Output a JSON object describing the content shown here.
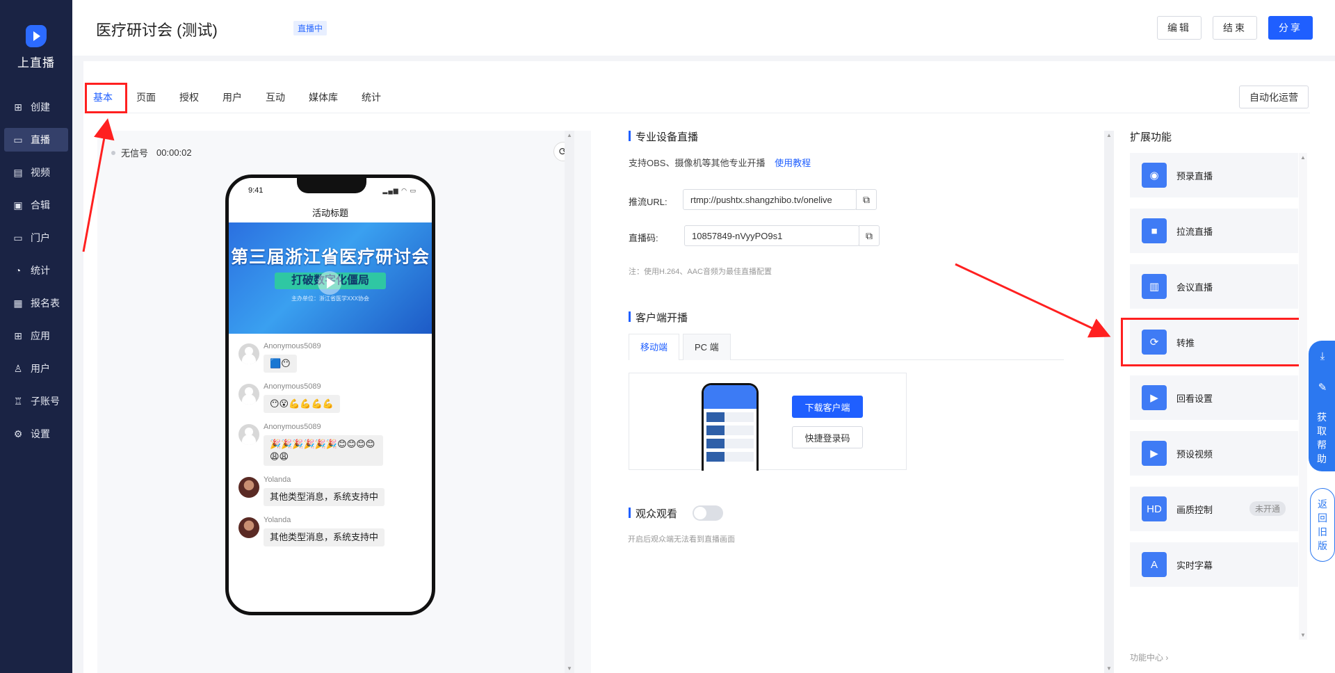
{
  "app": {
    "logo_text": "上直播"
  },
  "sidebar": {
    "items": [
      {
        "label": "创建",
        "icon": "plus-square-icon",
        "glyph": "⊞"
      },
      {
        "label": "直播",
        "icon": "video-camera-icon",
        "glyph": "▭"
      },
      {
        "label": "视频",
        "icon": "film-icon",
        "glyph": "▤"
      },
      {
        "label": "合辑",
        "icon": "collection-icon",
        "glyph": "▣"
      },
      {
        "label": "门户",
        "icon": "monitor-icon",
        "glyph": "▭"
      },
      {
        "label": "统计",
        "icon": "pie-chart-icon",
        "glyph": "◔"
      },
      {
        "label": "报名表",
        "icon": "form-icon",
        "glyph": "▦"
      },
      {
        "label": "应用",
        "icon": "apps-grid-icon",
        "glyph": "⊞"
      },
      {
        "label": "用户",
        "icon": "user-icon",
        "glyph": "♙"
      },
      {
        "label": "子账号",
        "icon": "sub-account-icon",
        "glyph": "♖"
      },
      {
        "label": "设置",
        "icon": "gear-icon",
        "glyph": "⚙"
      }
    ],
    "active_index": 1
  },
  "header": {
    "title": "医疗研讨会 (测试)",
    "status_badge": "直播中",
    "edit_label": "编辑",
    "end_label": "结束",
    "share_label": "分享"
  },
  "tabs": [
    "基本",
    "页面",
    "授权",
    "用户",
    "互动",
    "媒体库",
    "统计"
  ],
  "active_tab": "基本",
  "auto_ops_label": "自动化运营",
  "preview": {
    "signal_text": "无信号",
    "duration": "00:00:02",
    "phone_time": "9:41",
    "phone_title": "活动标题",
    "banner_title": "第三届浙江省医疗研讨会",
    "banner_subtitle": "打破数字化僵局",
    "banner_small": "主办单位：浙江省医学XXX协会",
    "messages": [
      {
        "user": "Anonymous5089",
        "text": "🟦😶",
        "avatar": "gray"
      },
      {
        "user": "Anonymous5089",
        "text": "😶😮💪💪💪💪",
        "avatar": "gray"
      },
      {
        "user": "Anonymous5089",
        "text": "🎉🎉🎉🎉🎉🎉😊😊😊😊😩😩",
        "avatar": "gray"
      },
      {
        "user": "Yolanda",
        "text": "其他类型消息，系统支持中",
        "avatar": "photo"
      },
      {
        "user": "Yolanda",
        "text": "其他类型消息，系统支持中",
        "avatar": "photo"
      }
    ]
  },
  "pro_device": {
    "title": "专业设备直播",
    "desc": "支持OBS、摄像机等其他专业开播",
    "tutorial_link": "使用教程",
    "push_url_label": "推流URL:",
    "push_url_value": "rtmp://pushtx.shangzhibo.tv/onelive",
    "stream_key_label": "直播码:",
    "stream_key_value": "10857849-nVyyPO9s1",
    "note": "注：使用H.264、AAC音频为最佳直播配置"
  },
  "client": {
    "title": "客户端开播",
    "tab_mobile": "移动端",
    "tab_pc": "PC 端",
    "download_label": "下载客户端",
    "quick_login_label": "快捷登录码"
  },
  "audience": {
    "title": "观众观看",
    "toggle_on": false,
    "note": "开启后观众端无法看到直播画面"
  },
  "extensions": {
    "title": "扩展功能",
    "items": [
      {
        "label": "预录直播",
        "icon": "record-icon",
        "glyph": "◉"
      },
      {
        "label": "拉流直播",
        "icon": "camera-pull-icon",
        "glyph": "■"
      },
      {
        "label": "会议直播",
        "icon": "meeting-icon",
        "glyph": "▥"
      },
      {
        "label": "转推",
        "icon": "relay-icon",
        "glyph": "⟳"
      },
      {
        "label": "回看设置",
        "icon": "playback-icon",
        "glyph": "▶"
      },
      {
        "label": "预设视频",
        "icon": "preset-video-icon",
        "glyph": "▶"
      },
      {
        "label": "画质控制",
        "icon": "hd-icon",
        "glyph": "HD",
        "badge": "未开通"
      },
      {
        "label": "实时字幕",
        "icon": "subtitle-icon",
        "glyph": "A"
      }
    ],
    "function_center": "功能中心 ›"
  },
  "floating": {
    "help_text": "获\n取\n帮\n助",
    "back_text": "返\n回\n旧\n版"
  },
  "colors": {
    "accent": "#1f5fff",
    "sidebar_bg": "#1a2344",
    "annotation": "#ff2020"
  }
}
